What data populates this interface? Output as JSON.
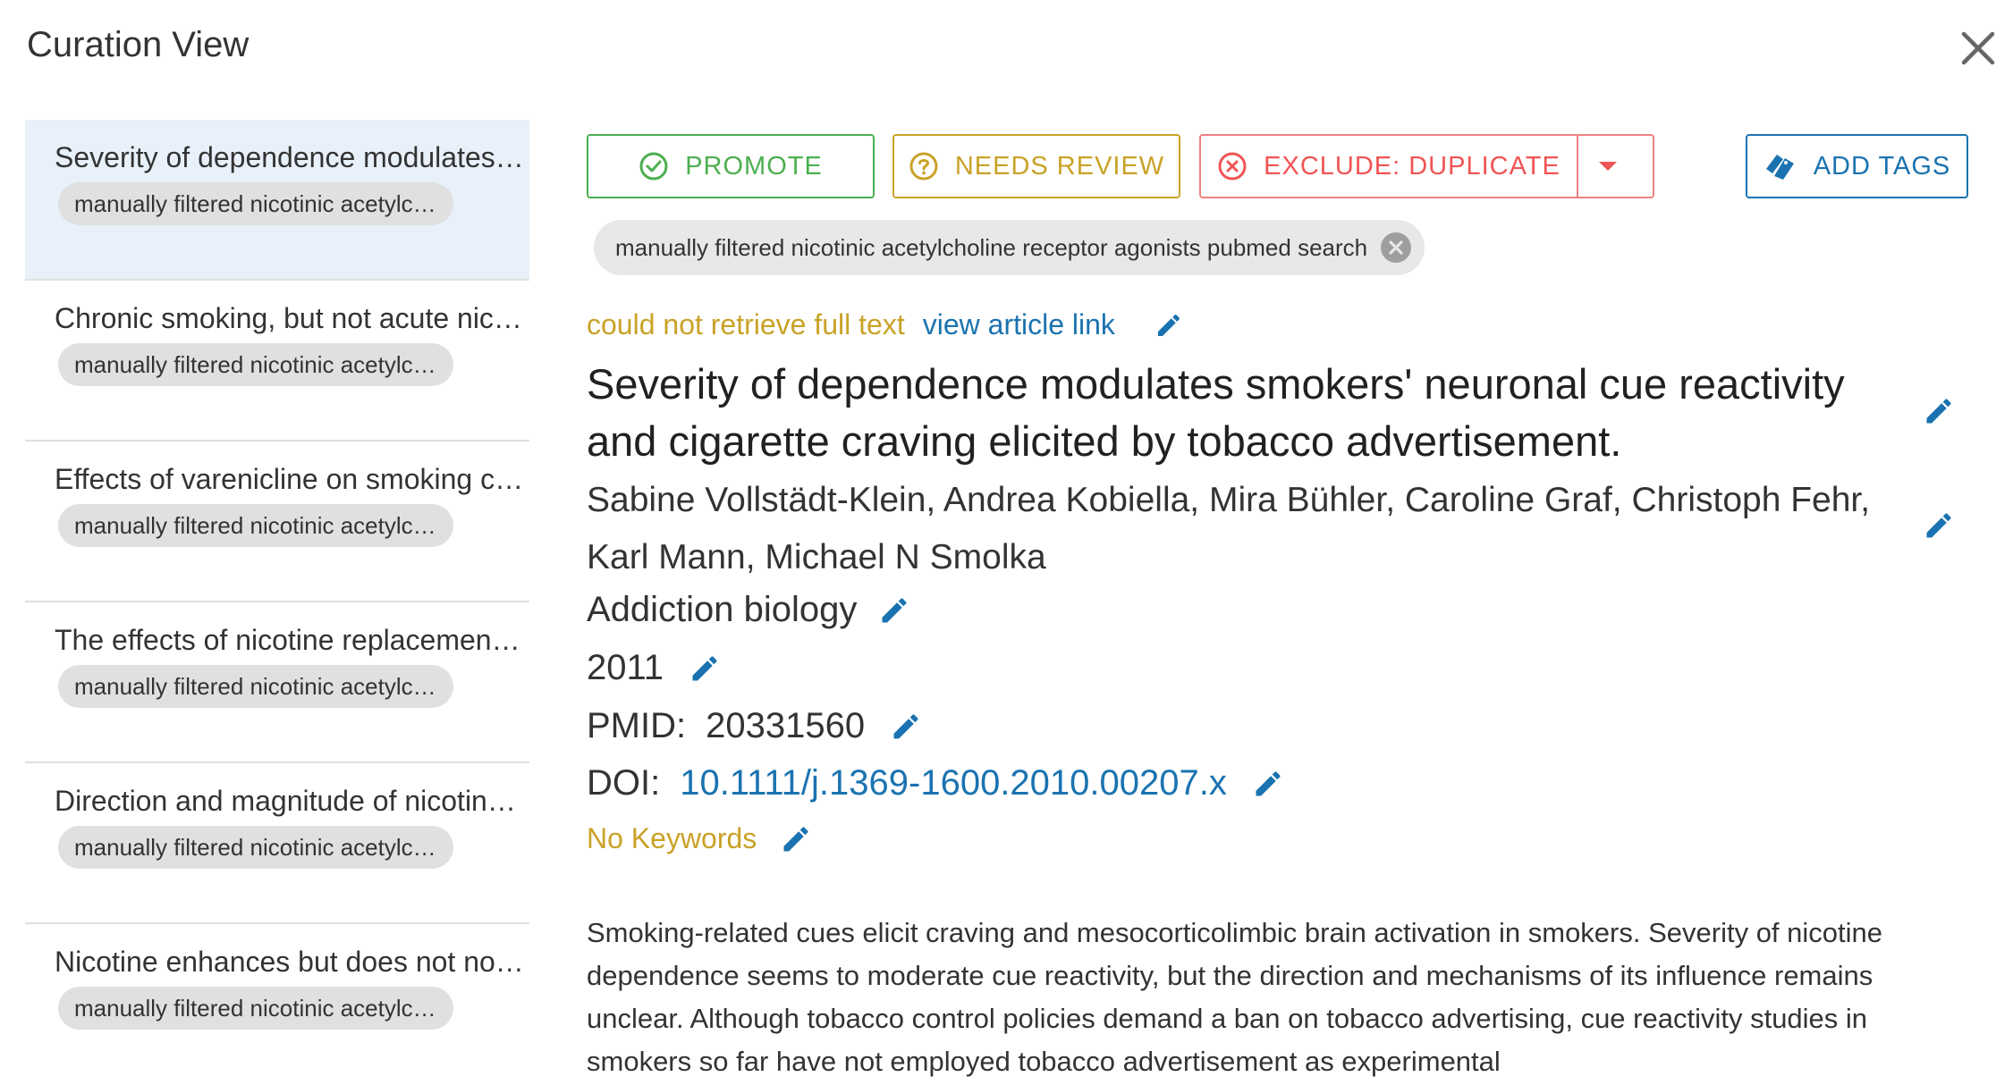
{
  "header": {
    "title": "Curation View"
  },
  "colors": {
    "promote": "#4caf50",
    "needs_review": "#c9a227",
    "exclude": "#f05454",
    "link": "#1a73b0",
    "selected_bg": "#e8f1f9"
  },
  "icons": {
    "close": "close-icon",
    "promote": "check-circle-icon",
    "review": "question-circle-icon",
    "exclude": "x-circle-icon",
    "dropdown": "caret-down-icon",
    "tags": "tags-icon",
    "edit": "pencil-icon"
  },
  "sidebar": {
    "items": [
      {
        "title": "Severity of dependence modulates smokers' neuronal cue reactivity and cigarette craving elicited by tobacco advertisement.",
        "tag": "manually filtered nicotinic acetylcholine receptor agonists pubmed search",
        "selected": true
      },
      {
        "title": "Chronic smoking, but not acute nicotine administration, modulates neural correlates",
        "tag": "manually filtered nicotinic acetylcholine receptor agonists pubmed search",
        "selected": false
      },
      {
        "title": "Effects of varenicline on smoking cue-triggered neural and craving responses",
        "tag": "manually filtered nicotinic acetylcholine receptor agonists pubmed search",
        "selected": false
      },
      {
        "title": "The effects of nicotine replacement therapy on cue reactivity",
        "tag": "manually filtered nicotinic acetylcholine receptor agonists pubmed search",
        "selected": false
      },
      {
        "title": "Direction and magnitude of nicotine effects on the fMRI BOLD response",
        "tag": "manually filtered nicotinic acetylcholine receptor agonists pubmed search",
        "selected": false
      },
      {
        "title": "Nicotine enhances but does not normalize visual sustained attention",
        "tag": "manually filtered nicotinic acetylcholine receptor agonists pubmed search",
        "selected": false
      }
    ]
  },
  "toolbar": {
    "promote_label": "PROMOTE",
    "needs_review_label": "NEEDS REVIEW",
    "exclude_label": "EXCLUDE: DUPLICATE",
    "add_tags_label": "ADD TAGS"
  },
  "article": {
    "tag": "manually filtered nicotinic acetylcholine receptor agonists pubmed search",
    "fulltext_status": "could not retrieve full text",
    "view_link": "view article link",
    "title": "Severity of dependence modulates smokers' neuronal cue reactivity and cigarette craving elicited by tobacco advertisement.",
    "authors": "Sabine Vollstädt-Klein, Andrea Kobiella, Mira Bühler, Caroline Graf, Christoph Fehr, Karl Mann, Michael N Smolka",
    "journal": "Addiction biology",
    "year": "2011",
    "pmid_label": "PMID:",
    "pmid": "20331560",
    "doi_label": "DOI:",
    "doi": "10.1111/j.1369-1600.2010.00207.x",
    "keywords": "No Keywords",
    "abstract": "Smoking-related cues elicit craving and mesocorticolimbic brain activation in smokers. Severity of nicotine dependence seems to moderate cue reactivity, but the direction and mechanisms of its influence remains unclear. Although tobacco control policies demand a ban on tobacco advertising, cue reactivity studies in smokers so far have not employed tobacco advertisement as experimental"
  }
}
